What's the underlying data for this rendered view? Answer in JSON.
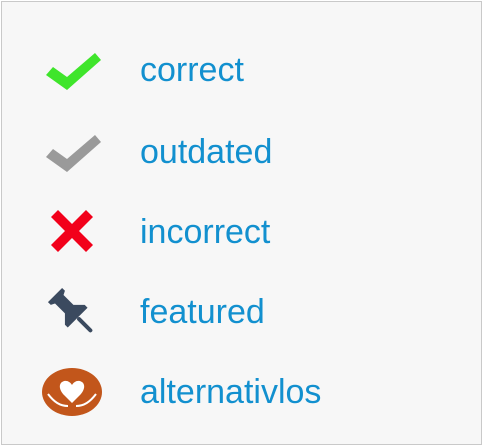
{
  "legend": {
    "label_color": "#1290cf",
    "items": [
      {
        "label": "correct",
        "icon": "check-icon",
        "icon_color": "#3fe52b"
      },
      {
        "label": "outdated",
        "icon": "check-icon",
        "icon_color": "#9a9a9a"
      },
      {
        "label": "incorrect",
        "icon": "cross-icon",
        "icon_color": "#f2001a"
      },
      {
        "label": "featured",
        "icon": "pushpin-icon",
        "icon_color": "#3b4a5f"
      },
      {
        "label": "alternativlos",
        "icon": "hands-heart-icon",
        "icon_color": "#c2561b"
      }
    ]
  }
}
